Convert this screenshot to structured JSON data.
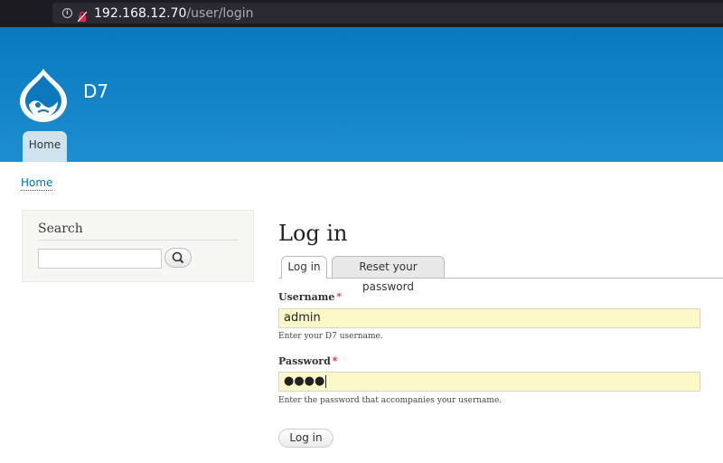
{
  "browser": {
    "url_host": "192.168.12.70",
    "url_path": "/user/login"
  },
  "site": {
    "name": "D7",
    "main_menu": [
      "Home"
    ]
  },
  "breadcrumb": {
    "home": "Home"
  },
  "sidebar": {
    "search_title": "Search",
    "search_value": ""
  },
  "page": {
    "title": "Log in",
    "tabs": [
      {
        "label": "Log in",
        "active": true
      },
      {
        "label": "Reset your password",
        "active": false
      }
    ]
  },
  "form": {
    "username": {
      "label": "Username",
      "required": "*",
      "value": "admin",
      "description": "Enter your D7 username."
    },
    "password": {
      "label": "Password",
      "required": "*",
      "value": "●●●●",
      "description": "Enter the password that accompanies your username."
    },
    "submit_label": "Log in"
  },
  "colors": {
    "header_top": "#0779bf",
    "header_bottom": "#1d8ecf",
    "link": "#0071b3",
    "field_bg": "#fcf8c8"
  }
}
